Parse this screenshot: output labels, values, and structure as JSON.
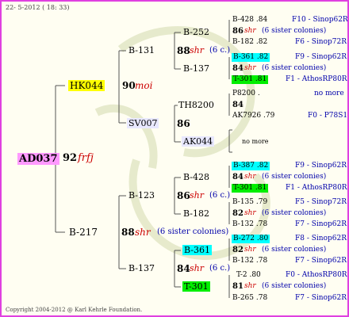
{
  "header": {
    "date": "22- 5-2012 ( 18: 33)"
  },
  "footer": {
    "copyright": "Copyright 2004-2012 @ Karl Kehrle Foundation."
  },
  "colors": {
    "border": "#e040e0",
    "root_bg": "#ff99ff",
    "yellow": "#ffff00",
    "cyan": "#00ffff",
    "green": "#00ee00",
    "lavender": "#e8e8ff"
  },
  "root": {
    "id": "AD037",
    "year": "92",
    "tag": "frfj"
  },
  "gen1": {
    "top": {
      "id": "HK044",
      "year": "90",
      "tag": "moi"
    },
    "bottom": {
      "id": "B-217",
      "year": "88",
      "tag": "shr",
      "note": "(6 sister colonies)"
    }
  },
  "gen2": {
    "b131": {
      "id": "B-131",
      "year": "88",
      "tag": "shr",
      "note": "(6 c.)"
    },
    "sv007": {
      "id": "SV007",
      "year": "86"
    },
    "b123": {
      "id": "B-123",
      "year": "86",
      "tag": "shr",
      "note": "(6 c.)"
    },
    "b137": {
      "id": "B-137",
      "year": "84",
      "tag": "shr",
      "note": "(6 c.)"
    }
  },
  "gen3": {
    "b252": {
      "id": "B-252"
    },
    "b137a": {
      "id": "B-137"
    },
    "th8200": {
      "id": "TH8200"
    },
    "ak044": {
      "id": "AK044"
    },
    "b428": {
      "id": "B-428"
    },
    "b182": {
      "id": "B-182"
    },
    "b361": {
      "id": "B-361"
    },
    "t301": {
      "id": "T-301"
    }
  },
  "gen4": [
    {
      "left": "B-428 .84",
      "right": "F10 - Sinop62R"
    },
    {
      "year": "86",
      "tag": "shr",
      "note": "(6 sister colonies)"
    },
    {
      "left": "B-182 .82",
      "right": "F6 - Sinop72R"
    },
    {
      "left": "B-361 .82",
      "right": "F9 - Sinop62R"
    },
    {
      "year": "84",
      "tag": "shr",
      "note": "(6 sister colonies)"
    },
    {
      "left": "T-301 .81",
      "right": "F1 - AthosRP80R"
    },
    {
      "left": "P8200 .",
      "right": "no more"
    },
    {
      "year": "84"
    },
    {
      "left": "AK7926 .79",
      "right": "F0 - P78S1"
    },
    {
      "center": "no more"
    },
    {
      "left": "B-387 .82",
      "right": "F9 - Sinop62R"
    },
    {
      "year": "84",
      "tag": "shr",
      "note": "(6 sister colonies)"
    },
    {
      "left": "T-301 .81",
      "right": "F1 - AthosRP80R"
    },
    {
      "left": "B-135 .79",
      "right": "F5 - Sinop72R"
    },
    {
      "year": "82",
      "tag": "shr",
      "note": "(6 sister colonies)"
    },
    {
      "left": "B-132 .78",
      "right": "F7 - Sinop62R"
    },
    {
      "left": "B-272 .80",
      "right": "F8 - Sinop62R"
    },
    {
      "year": "82",
      "tag": "shr",
      "note": "(6 sister colonies)"
    },
    {
      "left": "B-132 .78",
      "right": "F7 - Sinop62R"
    },
    {
      "left": "T-2 .80",
      "right": "F0 - AthosRP80R"
    },
    {
      "year": "81",
      "tag": "shr",
      "note": "(6 sister colonies)"
    },
    {
      "left": "B-265 .78",
      "right": "F7 - Sinop62R"
    }
  ]
}
